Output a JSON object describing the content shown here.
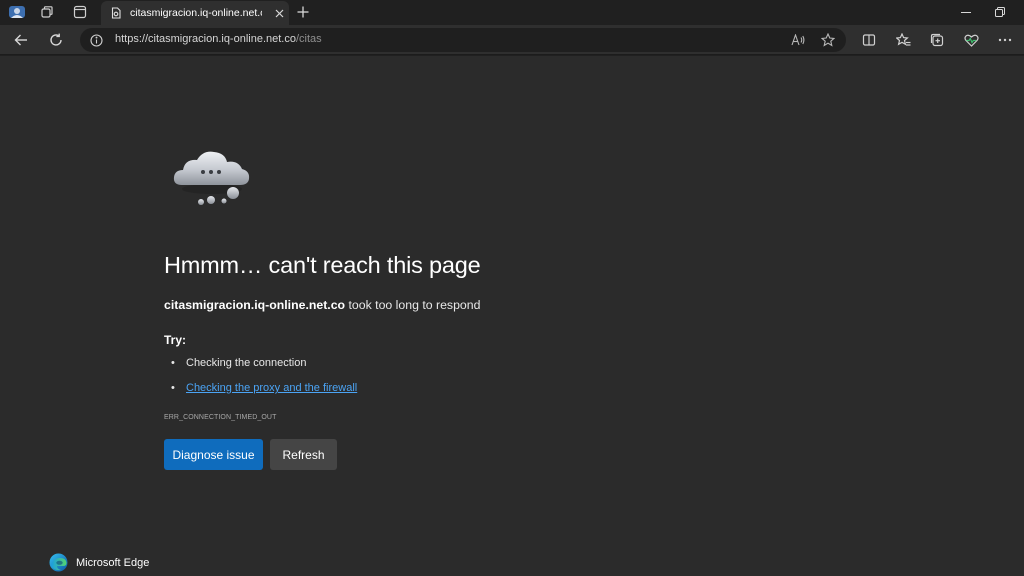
{
  "browser": {
    "tab": {
      "title": "citasmigracion.iq-online.net.co"
    },
    "address_bar": {
      "url_host": "https://citasmigracion.iq-online.net.co",
      "url_path": "/citas"
    }
  },
  "page": {
    "headline": "Hmmm… can't reach this page",
    "description": {
      "host": "citasmigracion.iq-online.net.co",
      "rest": " took too long to respond"
    },
    "try_label": "Try:",
    "suggestions": [
      {
        "text": "Checking the connection",
        "is_link": false
      },
      {
        "text": "Checking the proxy and the firewall",
        "is_link": true
      }
    ],
    "error_code": "ERR_CONNECTION_TIMED_OUT",
    "buttons": {
      "diagnose": "Diagnose issue",
      "refresh": "Refresh"
    },
    "brand": "Microsoft Edge"
  },
  "colors": {
    "accent": "#0f6cbd",
    "link": "#4ba4f5",
    "page_background": "#2b2b2b"
  }
}
